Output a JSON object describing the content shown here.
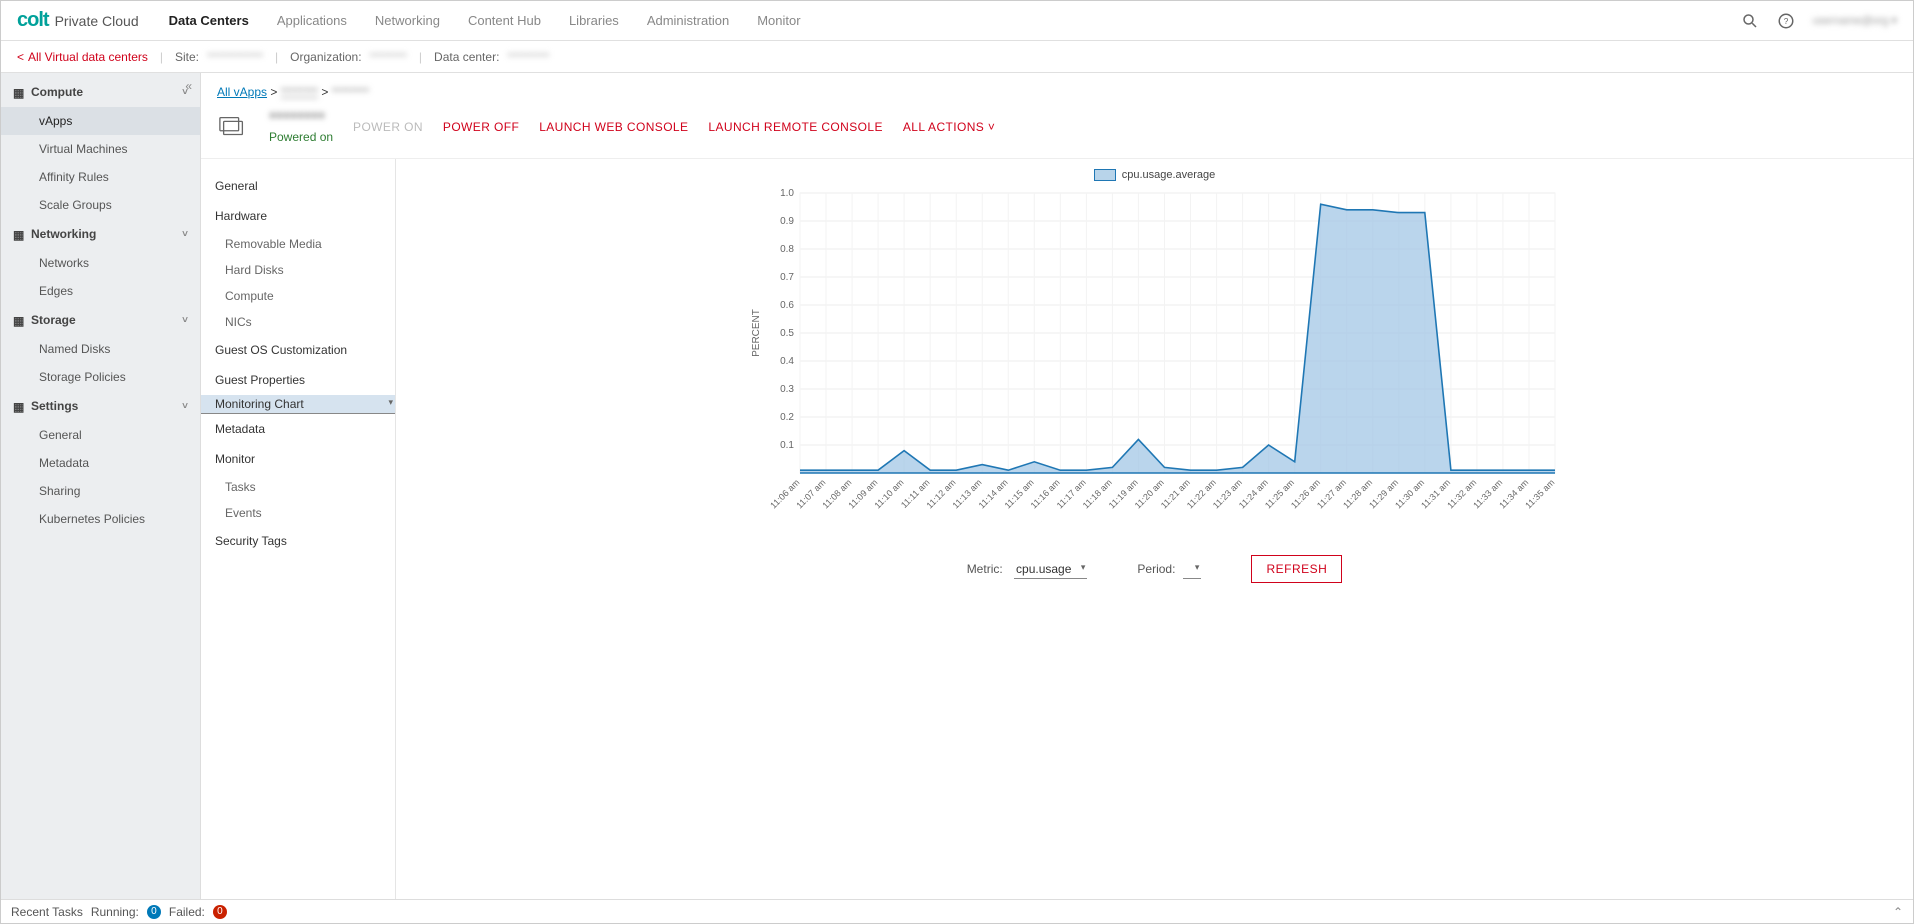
{
  "brand": {
    "logo": "colt",
    "product": "Private Cloud"
  },
  "nav": [
    "Data Centers",
    "Applications",
    "Networking",
    "Content Hub",
    "Libraries",
    "Administration",
    "Monitor"
  ],
  "nav_active": 0,
  "ctx": {
    "back": "All Virtual data centers",
    "site_label": "Site:",
    "site_val": "************",
    "org_label": "Organization:",
    "org_val": "********",
    "dc_label": "Data center:",
    "dc_val": "*********"
  },
  "sidebar": {
    "groups": [
      {
        "label": "Compute",
        "items": [
          "vApps",
          "Virtual Machines",
          "Affinity Rules",
          "Scale Groups"
        ],
        "active": 0
      },
      {
        "label": "Networking",
        "items": [
          "Networks",
          "Edges"
        ]
      },
      {
        "label": "Storage",
        "items": [
          "Named Disks",
          "Storage Policies"
        ]
      },
      {
        "label": "Settings",
        "items": [
          "General",
          "Metadata",
          "Sharing",
          "Kubernetes Policies"
        ]
      }
    ]
  },
  "subpanel": [
    {
      "label": "General"
    },
    {
      "label": "Hardware",
      "children": [
        "Removable Media",
        "Hard Disks",
        "Compute",
        "NICs"
      ]
    },
    {
      "label": "Guest OS Customization"
    },
    {
      "label": "Guest Properties"
    },
    {
      "label": "Monitoring Chart",
      "selected": true
    },
    {
      "label": "Metadata"
    },
    {
      "label": "Monitor",
      "children": [
        "Tasks",
        "Events"
      ]
    },
    {
      "label": "Security Tags"
    }
  ],
  "breadcrumb": {
    "root": "All vApps",
    "mid": "********",
    "leaf": "********"
  },
  "vm": {
    "name": "********",
    "status": "Powered on"
  },
  "actions": [
    "POWER ON",
    "POWER OFF",
    "LAUNCH WEB CONSOLE",
    "LAUNCH REMOTE CONSOLE",
    "ALL ACTIONS"
  ],
  "actions_disabled": [
    0
  ],
  "chart_data": {
    "type": "area",
    "title": "",
    "legend": "cpu.usage.average",
    "xlabel": "",
    "ylabel": "PERCENT",
    "ylim": [
      0,
      1.0
    ],
    "yticks": [
      0.1,
      0.2,
      0.3,
      0.4,
      0.5,
      0.6,
      0.7,
      0.8,
      0.9,
      1.0
    ],
    "x": [
      "11:06 am",
      "11:07 am",
      "11:08 am",
      "11:09 am",
      "11:10 am",
      "11:11 am",
      "11:12 am",
      "11:13 am",
      "11:14 am",
      "11:15 am",
      "11:16 am",
      "11:17 am",
      "11:18 am",
      "11:19 am",
      "11:20 am",
      "11:21 am",
      "11:22 am",
      "11:23 am",
      "11:24 am",
      "11:25 am",
      "11:26 am",
      "11:27 am",
      "11:28 am",
      "11:29 am",
      "11:30 am",
      "11:31 am",
      "11:32 am",
      "11:33 am",
      "11:34 am",
      "11:35 am"
    ],
    "values": [
      0.01,
      0.01,
      0.01,
      0.01,
      0.08,
      0.01,
      0.01,
      0.03,
      0.01,
      0.04,
      0.01,
      0.01,
      0.02,
      0.12,
      0.02,
      0.01,
      0.01,
      0.02,
      0.1,
      0.04,
      0.96,
      0.94,
      0.94,
      0.93,
      0.93,
      0.01,
      0.01,
      0.01,
      0.01,
      0.01
    ]
  },
  "controls": {
    "metric_label": "Metric:",
    "metric_value": "cpu.usage",
    "period_label": "Period:",
    "period_value": "",
    "refresh": "REFRESH"
  },
  "footer": {
    "title": "Recent Tasks",
    "running_label": "Running:",
    "running": 0,
    "failed_label": "Failed:",
    "failed": 0
  }
}
